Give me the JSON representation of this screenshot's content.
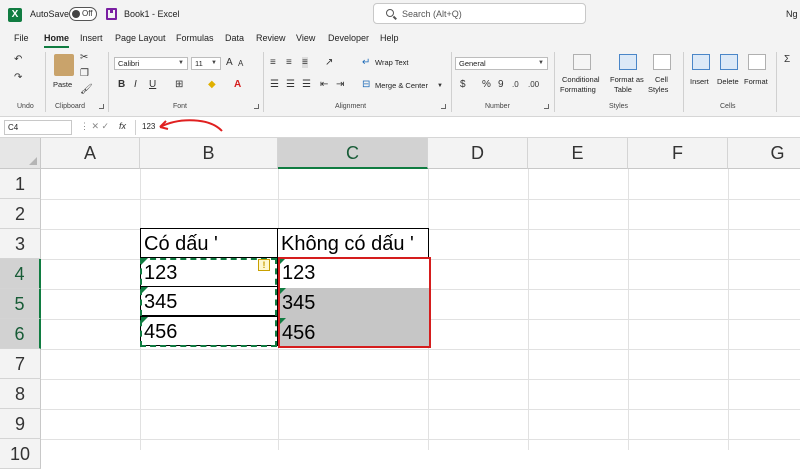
{
  "titlebar": {
    "autosave_label": "AutoSave",
    "autosave_state": "Off",
    "doc_title": "Book1 - Excel",
    "search_placeholder": "Search (Alt+Q)",
    "user_name": "Ng"
  },
  "tabs": [
    "File",
    "Home",
    "Insert",
    "Page Layout",
    "Formulas",
    "Data",
    "Review",
    "View",
    "Developer",
    "Help"
  ],
  "active_tab": "Home",
  "ribbon": {
    "undo_group": "Undo",
    "clipboard": {
      "label": "Clipboard",
      "paste": "Paste"
    },
    "font": {
      "label": "Font",
      "name": "Calibri",
      "size": "11",
      "bold": "B",
      "italic": "I",
      "underline": "U",
      "grow": "A",
      "shrink": "A"
    },
    "alignment": {
      "label": "Alignment",
      "wrap_text": "Wrap Text",
      "merge_center": "Merge & Center"
    },
    "number": {
      "label": "Number",
      "format": "General",
      "currency": "$",
      "percent": "%",
      "comma": "9"
    },
    "styles": {
      "label": "Styles",
      "conditional": "Conditional",
      "formatting": "Formatting",
      "format_as": "Format as",
      "table": "Table",
      "cell": "Cell",
      "cell_styles": "Styles"
    },
    "cells": {
      "label": "Cells",
      "insert": "Insert",
      "delete": "Delete",
      "format": "Format"
    }
  },
  "formula_bar": {
    "name_box": "C4",
    "fx": "fx",
    "value": "123"
  },
  "columns": [
    "A",
    "B",
    "C",
    "D",
    "E",
    "F",
    "G"
  ],
  "rows": [
    "1",
    "2",
    "3",
    "4",
    "5",
    "6",
    "7",
    "8",
    "9",
    "10"
  ],
  "selected_column": "C",
  "selected_rows": [
    "4",
    "5",
    "6"
  ],
  "cells": {
    "B3": "Có dấu '",
    "C3": "Không có dấu '",
    "B4": "123",
    "B5": "345",
    "B6": "456",
    "C4": "123",
    "C5": "345",
    "C6": "456"
  },
  "colors": {
    "accent": "#107c41",
    "selection_outline": "#d51d1d",
    "annotation_arrow": "#e02020",
    "selected_fill": "#c6c6c6"
  }
}
